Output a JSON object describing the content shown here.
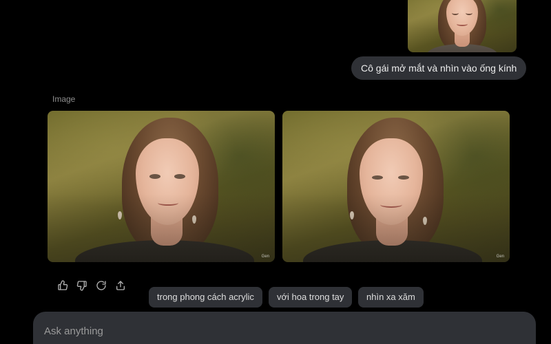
{
  "user_message": {
    "text": "Cô gái mở mắt và nhìn vào ống kính",
    "attachment_thumbnail": {
      "alt": "girl with closed eyes portrait"
    }
  },
  "response": {
    "label": "Image",
    "images": [
      {
        "alt": "generated portrait 1",
        "watermark": "Gen"
      },
      {
        "alt": "generated portrait 2",
        "watermark": "Gen"
      }
    ]
  },
  "actions": [
    {
      "name": "thumbs-up-icon"
    },
    {
      "name": "thumbs-down-icon"
    },
    {
      "name": "regenerate-icon"
    },
    {
      "name": "share-icon"
    }
  ],
  "suggestions": [
    {
      "label": "trong phong cách acrylic"
    },
    {
      "label": "với hoa trong tay"
    },
    {
      "label": "nhìn xa xăm"
    }
  ],
  "composer": {
    "placeholder": "Ask anything"
  },
  "colors": {
    "background": "#000000",
    "bubble": "#2f3136",
    "text": "#ececec",
    "muted": "#8e8e8e"
  }
}
